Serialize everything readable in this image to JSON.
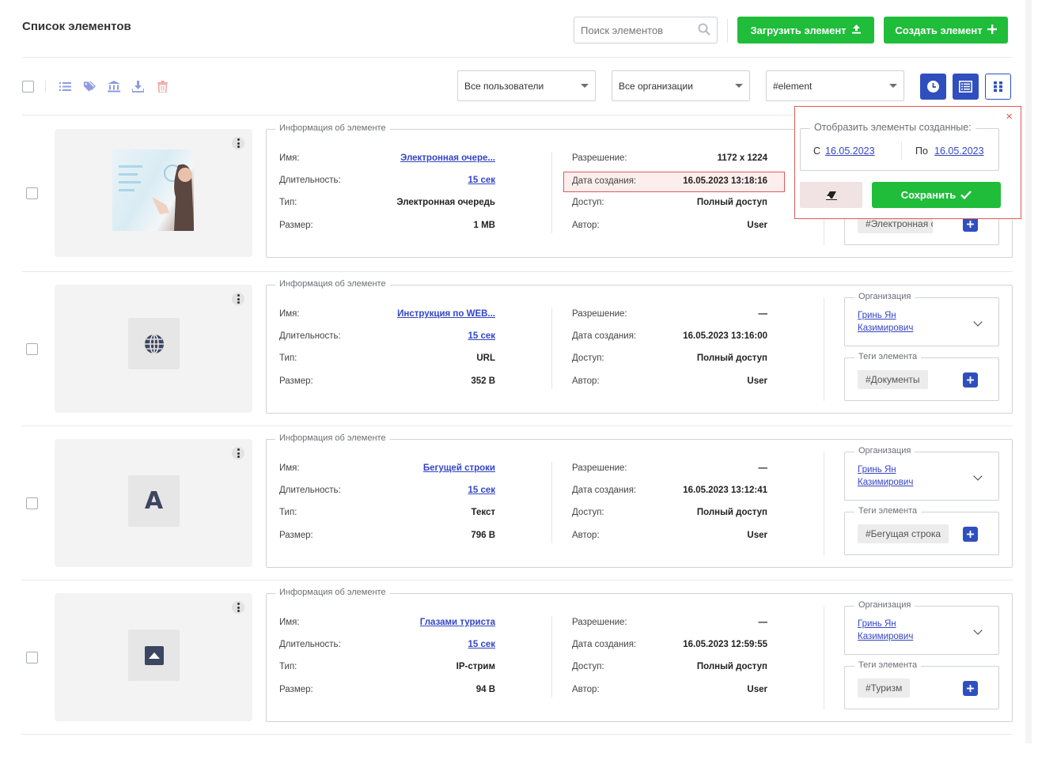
{
  "page_title": "Список элементов",
  "search": {
    "placeholder": "Поиск элементов"
  },
  "buttons": {
    "upload": "Загрузить элемент",
    "create": "Создать элемент"
  },
  "filters": {
    "users": "Все пользователи",
    "orgs": "Все организации",
    "tag": "#element"
  },
  "labels": {
    "info_legend": "Информация об элементе",
    "name": "Имя:",
    "duration": "Длительность:",
    "type": "Тип:",
    "size": "Размер:",
    "resolution": "Разрешение:",
    "created": "Дата создания:",
    "access": "Доступ:",
    "author": "Автор:",
    "org_legend": "Организация",
    "tags_legend": "Теги элемента"
  },
  "popup": {
    "legend": "Отобразить элементы созданные:",
    "from_label": "С",
    "from_value": "16.05.2023",
    "to_label": "По",
    "to_value": "16.05.2023",
    "save": "Сохранить"
  },
  "items": [
    {
      "name": "Электронная очере...",
      "duration": "15 сек",
      "type": "Электронная очередь",
      "size": "1 MB",
      "resolution": "1172 x 1224",
      "created": "16.05.2023 13:18:16",
      "access": "Полный доступ",
      "author": "User",
      "org": "",
      "tag": "#Электронная очер",
      "thumb": "photo"
    },
    {
      "name": "Инструкция по WEB...",
      "duration": "15 сек",
      "type": "URL",
      "size": "352 B",
      "resolution": "—",
      "created": "16.05.2023 13:16:00",
      "access": "Полный доступ",
      "author": "User",
      "org": "Гринь Ян Казимирович",
      "tag": "#Документы",
      "thumb": "globe-icon"
    },
    {
      "name": "Бегущей строки",
      "duration": "15 сек",
      "type": "Текст",
      "size": "796 B",
      "resolution": "—",
      "created": "16.05.2023 13:12:41",
      "access": "Полный доступ",
      "author": "User",
      "org": "Гринь Ян Казимирович",
      "tag": "#Бегущая строка",
      "thumb": "text-icon",
      "thumb_letter": "A"
    },
    {
      "name": "Глазами туриста",
      "duration": "15 сек",
      "type": "IP-стрим",
      "size": "94 B",
      "resolution": "—",
      "created": "16.05.2023 12:59:55",
      "access": "Полный доступ",
      "author": "User",
      "org": "Гринь Ян Казимирович",
      "tag": "#Туризм",
      "thumb": "stream-icon"
    }
  ],
  "colors": {
    "accent": "#2f4fbf",
    "green": "#1fbd3a",
    "danger": "#e05a5a",
    "link": "#3445c6"
  }
}
